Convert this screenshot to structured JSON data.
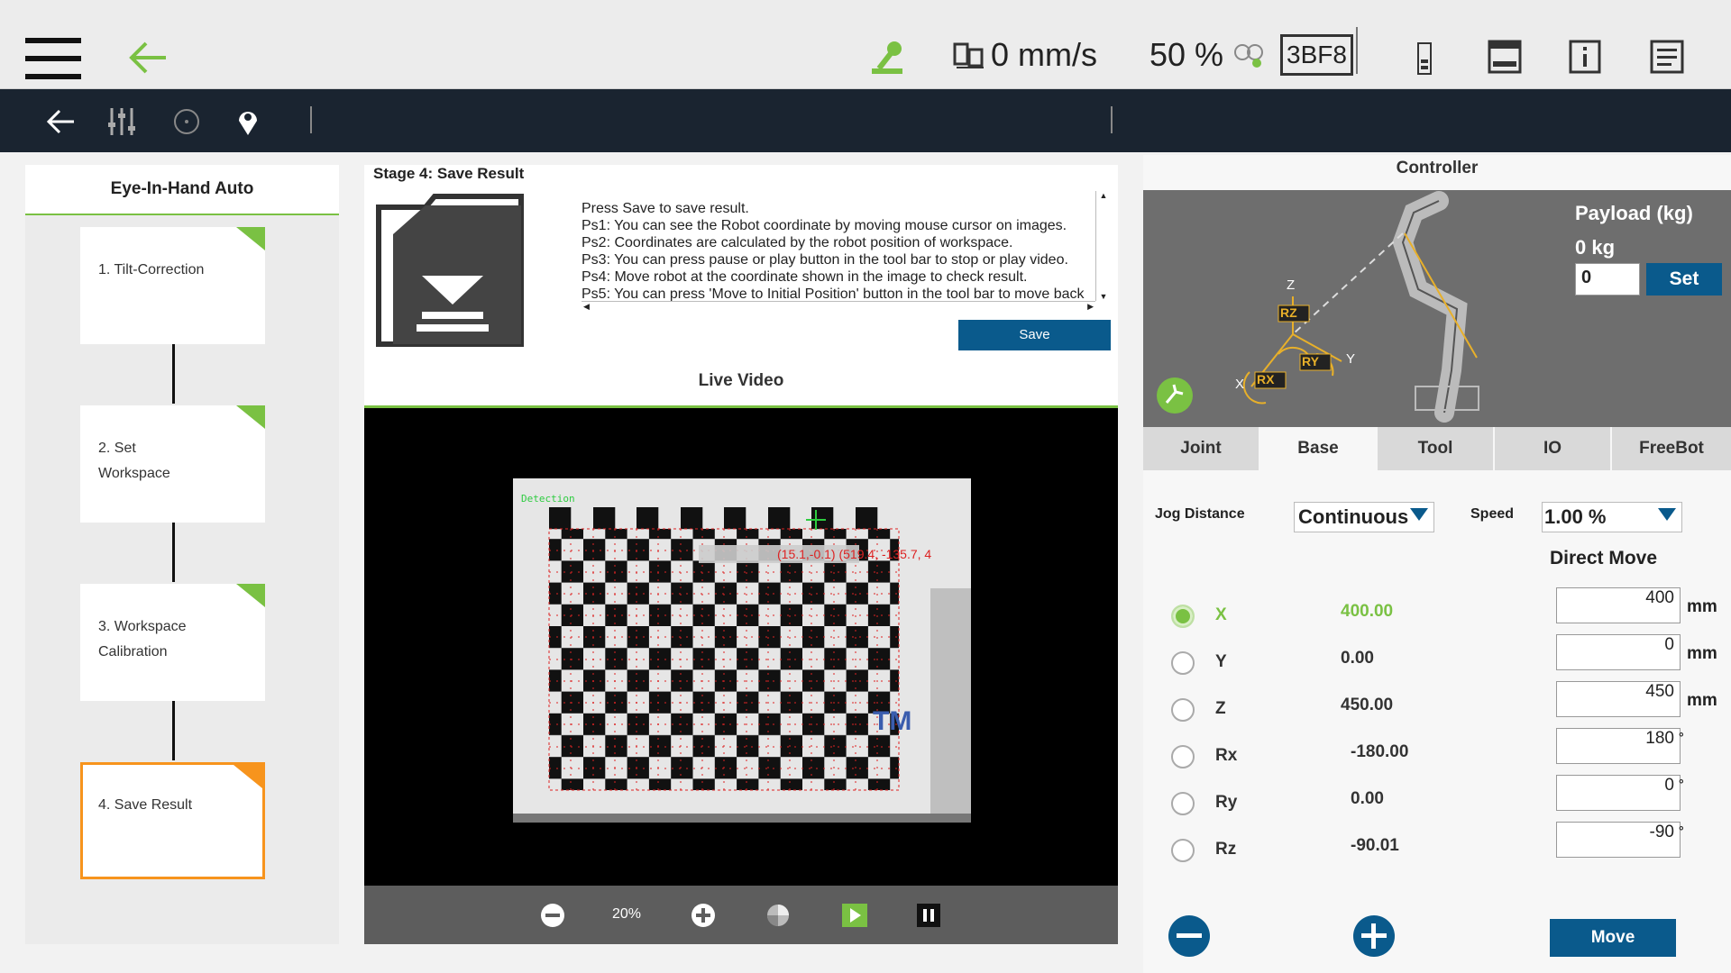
{
  "topbar": {
    "speed": "0 mm/s",
    "percent": "50 %",
    "code": "3BF8"
  },
  "left": {
    "title": "Eye-In-Hand Auto",
    "stages": [
      {
        "label": "1. Tilt-Correction",
        "active": false
      },
      {
        "label": "2. Set\n    Workspace",
        "active": false
      },
      {
        "label": "3. Workspace\n    Calibration",
        "active": false
      },
      {
        "label": "4. Save Result",
        "active": true
      }
    ]
  },
  "stage": {
    "title": "Stage 4: Save Result",
    "lines": [
      "Press Save to save result.",
      "Ps1: You can see the Robot coordinate by moving mouse cursor on images.",
      "Ps2: Coordinates are calculated by the robot position of workspace.",
      "Ps3: You can press pause or play button in the tool bar to stop or play video.",
      "Ps4: Move robot at the coordinate shown in the image to check result.",
      "Ps5: You can press 'Move to Initial Position' button in the tool bar to move back"
    ],
    "save_label": "Save"
  },
  "video": {
    "title": "Live Video",
    "detection_label": "Detection",
    "tooltip": "(15.1,-0.1) (519.4, -135.7, 4",
    "zoom": "20%",
    "logo": "TM"
  },
  "controller": {
    "title": "Controller",
    "payload_label": "Payload (kg)",
    "payload_value": "0 kg",
    "payload_input": "0",
    "set_label": "Set",
    "axis_tags": {
      "rz": "RZ",
      "ry": "RY",
      "rx": "RX",
      "z": "Z",
      "y": "Y",
      "x": "X"
    },
    "tabs": [
      "Joint",
      "Base",
      "Tool",
      "IO",
      "FreeBot"
    ],
    "active_tab": "Base",
    "jog_distance_label": "Jog Distance",
    "jog_distance_value": "Continuous",
    "speed_label": "Speed",
    "speed_value": "1.00 %",
    "direct_move_label": "Direct Move",
    "axes": [
      {
        "name": "X",
        "value": "400.00",
        "input": "400",
        "unit": "mm",
        "selected": true
      },
      {
        "name": "Y",
        "value": "0.00",
        "input": "0",
        "unit": "mm",
        "selected": false
      },
      {
        "name": "Z",
        "value": "450.00",
        "input": "450",
        "unit": "mm",
        "selected": false
      },
      {
        "name": "Rx",
        "value": "-180.00",
        "input": "180",
        "unit": "°",
        "selected": false
      },
      {
        "name": "Ry",
        "value": "0.00",
        "input": "0",
        "unit": "°",
        "selected": false
      },
      {
        "name": "Rz",
        "value": "-90.01",
        "input": "-90",
        "unit": "°",
        "selected": false
      }
    ],
    "move_label": "Move"
  },
  "colors": {
    "accent_green": "#7ac143",
    "nav_dark": "#1a2430",
    "button_blue": "#0a5a8c",
    "active_orange": "#f7941d"
  }
}
